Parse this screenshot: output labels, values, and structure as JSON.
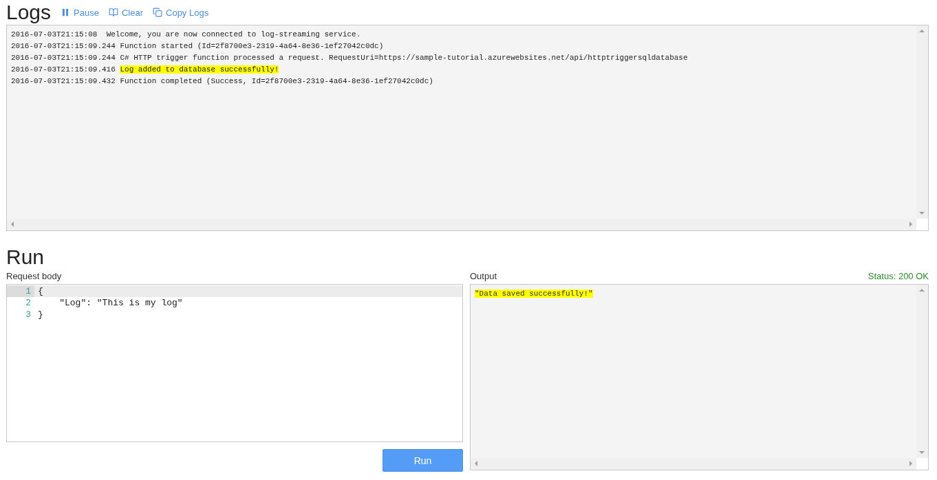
{
  "logs": {
    "title": "Logs",
    "actions": [
      {
        "kind": "pause",
        "label": "Pause"
      },
      {
        "kind": "clear",
        "label": "Clear"
      },
      {
        "kind": "copy",
        "label": "Copy Logs"
      }
    ],
    "lines": [
      {
        "time": "2016-07-03T21:15:08",
        "message": " Welcome, you are now connected to log-streaming service.",
        "highlighted": false
      },
      {
        "time": "2016-07-03T21:15:09.244",
        "message": "Function started (Id=2f8700e3-2319-4a64-8e36-1ef27042c0dc)",
        "highlighted": false
      },
      {
        "time": "2016-07-03T21:15:09.244",
        "message": "C# HTTP trigger function processed a request. RequestUri=https://sample-tutorial.azurewebsites.net/api/httptriggersqldatabase",
        "highlighted": false
      },
      {
        "time": "2016-07-03T21:15:09.416",
        "message": "Log added to database successfully!",
        "highlighted": true
      },
      {
        "time": "2016-07-03T21:15:09.432",
        "message": "Function completed (Success, Id=2f8700e3-2319-4a64-8e36-1ef27042c0dc)",
        "highlighted": false
      }
    ]
  },
  "run": {
    "title": "Run",
    "request_label": "Request body",
    "code_lines": [
      {
        "number": "1",
        "text": "{",
        "active": true
      },
      {
        "number": "2",
        "text": "    \"Log\": \"This is my log\"",
        "active": false
      },
      {
        "number": "3",
        "text": "}",
        "active": false
      }
    ],
    "run_button": "Run",
    "output_label": "Output",
    "status": "Status: 200 OK",
    "output": {
      "text": "\"Data saved successfully!\"",
      "highlighted": true
    }
  }
}
